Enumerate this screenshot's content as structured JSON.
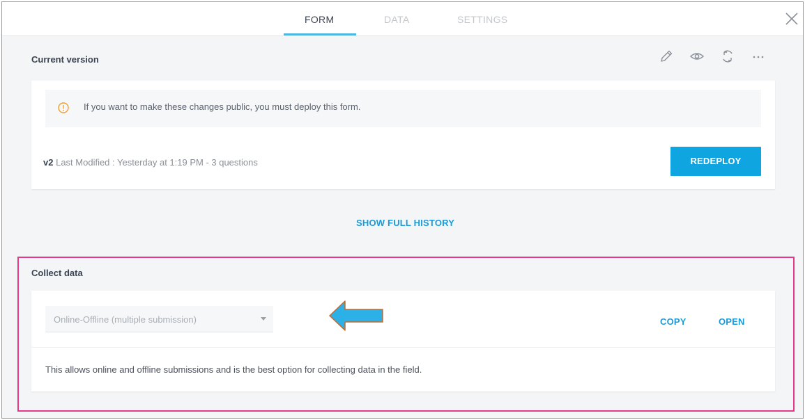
{
  "tabs": [
    {
      "label": "FORM",
      "active": true
    },
    {
      "label": "DATA",
      "active": false
    },
    {
      "label": "SETTINGS",
      "active": false
    }
  ],
  "current_version": {
    "title": "Current version",
    "toolbar_icons": [
      "pencil-icon",
      "eye-icon",
      "refresh-icon",
      "more-icon"
    ],
    "notice": "If you want to make these changes public, you must deploy this form.",
    "version_tag": "v2",
    "version_details": "Last Modified : Yesterday at 1:19 PM - 3 questions",
    "redeploy_label": "REDEPLOY"
  },
  "history_link": "SHOW FULL HISTORY",
  "collect_data": {
    "title": "Collect data",
    "selected_option": "Online-Offline (multiple submission)",
    "copy_label": "COPY",
    "open_label": "OPEN",
    "description": "This allows online and offline submissions and is the best option for collecting data in the field."
  },
  "colors": {
    "accent": "#0ea5e0",
    "highlight": "#e6388a",
    "arrow": "#2bb0e8",
    "warning": "#f0a030"
  }
}
